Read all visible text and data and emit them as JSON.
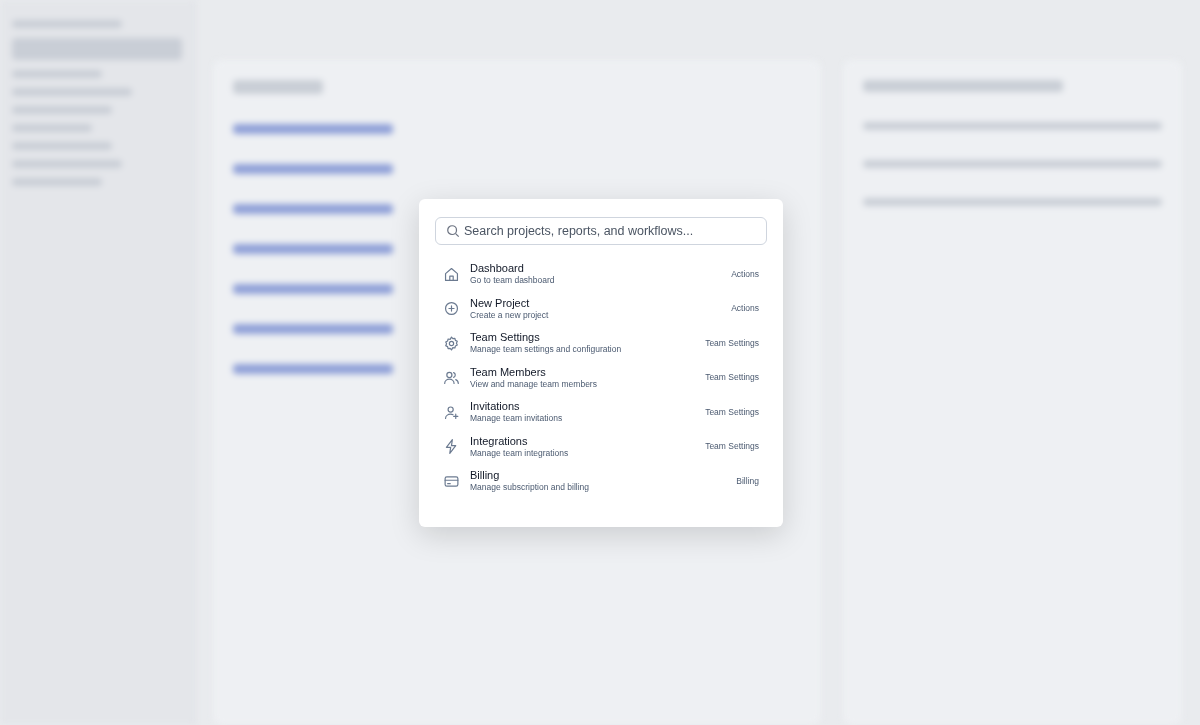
{
  "command_palette": {
    "search": {
      "placeholder": "Search projects, reports, and workflows..."
    },
    "items": [
      {
        "title": "Dashboard",
        "subtitle": "Go to team dashboard",
        "group": "Actions"
      },
      {
        "title": "New Project",
        "subtitle": "Create a new project",
        "group": "Actions"
      },
      {
        "title": "Team Settings",
        "subtitle": "Manage team settings and configuration",
        "group": "Team Settings"
      },
      {
        "title": "Team Members",
        "subtitle": "View and manage team members",
        "group": "Team Settings"
      },
      {
        "title": "Invitations",
        "subtitle": "Manage team invitations",
        "group": "Team Settings"
      },
      {
        "title": "Integrations",
        "subtitle": "Manage team integrations",
        "group": "Team Settings"
      },
      {
        "title": "Billing",
        "subtitle": "Manage subscription and billing",
        "group": "Billing"
      }
    ]
  }
}
